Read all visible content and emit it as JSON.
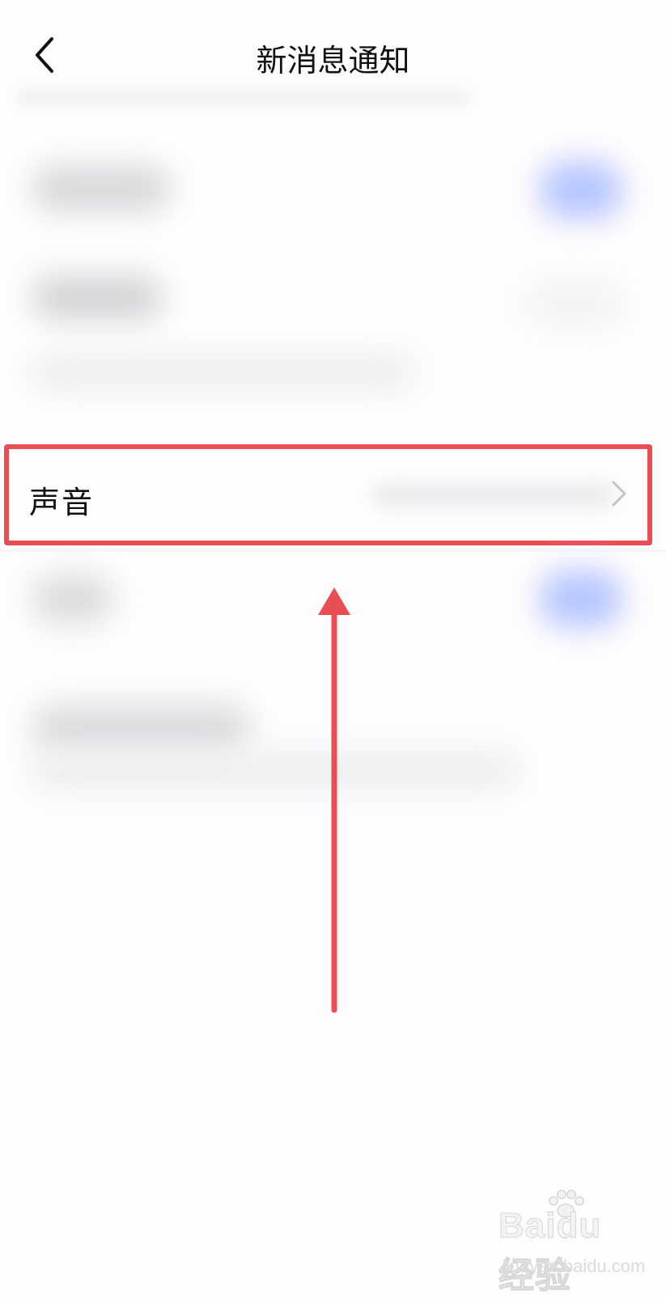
{
  "header": {
    "title": "新消息通知",
    "back_icon": "chevron-left-icon"
  },
  "sound_row": {
    "label": "声音",
    "chevron_icon": "chevron-right-icon"
  },
  "annotation": {
    "color": "#ea4e55"
  },
  "watermark": {
    "logo": "Baidu经验",
    "url": "jingyan.baidu.com"
  },
  "colors": {
    "background": "#fefcfd",
    "toggle_accent": "#b6c6ff",
    "text": "#111111"
  }
}
